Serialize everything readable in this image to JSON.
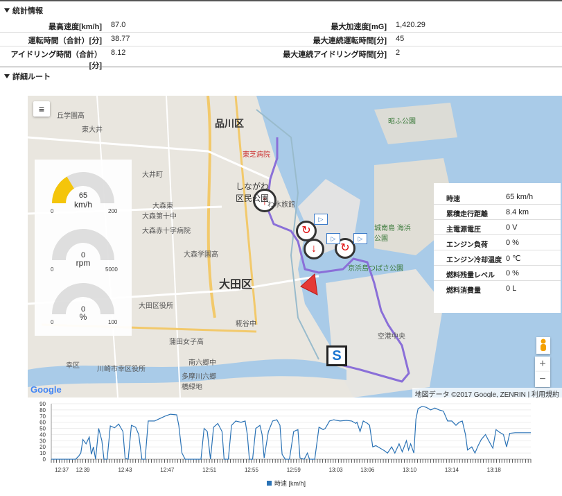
{
  "stats": {
    "title": "統計情報",
    "rows": [
      {
        "l1": "最高速度[km/h]",
        "v1": "87.0",
        "l2": "最大加速度[mG]",
        "v2": "1,420.29"
      },
      {
        "l1": "運転時間（合計）[分]",
        "v1": "38.77",
        "l2": "最大連続運転時間[分]",
        "v2": "45"
      },
      {
        "l1": "アイドリング時間（合計）[分]",
        "v1": "8.12",
        "l2": "最大連続アイドリング時間[分]",
        "v2": "2"
      }
    ]
  },
  "route": {
    "title": "詳細ルート",
    "menu_icon": "hamburger-icon",
    "gauges": [
      {
        "value": "65",
        "unit": "km/h",
        "min": "0",
        "max": "200",
        "fraction": 0.325,
        "color": "#f5c400"
      },
      {
        "value": "0",
        "unit": "rpm",
        "min": "0",
        "max": "5000",
        "fraction": 0,
        "color": "#f5c400"
      },
      {
        "value": "0",
        "unit": "%",
        "min": "0",
        "max": "100",
        "fraction": 0,
        "color": "#f5c400"
      }
    ],
    "info": [
      {
        "label": "時速",
        "value": "65 km/h"
      },
      {
        "label": "累積走行距離",
        "value": "8.4 km"
      },
      {
        "label": "主電源電圧",
        "value": "0 V"
      },
      {
        "label": "エンジン負荷",
        "value": "0 %"
      },
      {
        "label": "エンジン冷却温度",
        "value": "0 ℃"
      },
      {
        "label": "燃料残量レベル",
        "value": "0 %"
      },
      {
        "label": "燃料消費量",
        "value": "0 L"
      }
    ],
    "map_labels": [
      "品川区",
      "大田区",
      "しながわ 区民公園",
      "わ水族館",
      "城南島 海浜公園",
      "京浜島つばさ公園",
      "昭ふ公園",
      "大森学園高",
      "大森第十中",
      "大森赤十字病院",
      "東芝病院",
      "大田区役所",
      "糀谷中",
      "蒲田女子高",
      "南六郷中",
      "川崎市幸区役所",
      "多摩川六郷 橋緑地",
      "幸区",
      "丘学園高",
      "大井町",
      "東大井",
      "大森東",
      "空港中央"
    ],
    "google_logo": "Google",
    "attribution": "地図データ ©2017 Google, ZENRIN",
    "terms": "利用規約",
    "zoom_in": "+",
    "zoom_out": "−",
    "route_color": "#8a6fd8"
  },
  "chart_data": {
    "type": "line",
    "ylim": [
      0,
      90
    ],
    "yticks": [
      "0",
      "10",
      "20",
      "30",
      "40",
      "50",
      "60",
      "70",
      "80",
      "90"
    ],
    "xlim_minutes": [
      36.0,
      81.5
    ],
    "xticks": [
      "12:37",
      "12:39",
      "12:43",
      "12:47",
      "12:51",
      "12:55",
      "12:59",
      "13:03",
      "13:06",
      "13:10",
      "13:14",
      "13:18"
    ],
    "xtick_minutes": [
      37,
      39,
      43,
      47,
      51,
      55,
      59,
      63,
      66,
      70,
      74,
      78
    ],
    "series": [
      {
        "name": "時速 [km/h]",
        "color": "#2a72b5",
        "points": [
          [
            36.0,
            0
          ],
          [
            38.3,
            0
          ],
          [
            38.6,
            5
          ],
          [
            38.8,
            10
          ],
          [
            39.0,
            32
          ],
          [
            39.3,
            25
          ],
          [
            39.6,
            36
          ],
          [
            39.8,
            8
          ],
          [
            40.0,
            20
          ],
          [
            40.2,
            0
          ],
          [
            40.5,
            50
          ],
          [
            40.8,
            30
          ],
          [
            41.0,
            0
          ],
          [
            41.3,
            0
          ],
          [
            41.6,
            54
          ],
          [
            42.0,
            51
          ],
          [
            42.4,
            57
          ],
          [
            42.8,
            45
          ],
          [
            43.0,
            2
          ],
          [
            43.3,
            0
          ],
          [
            43.6,
            55
          ],
          [
            44.0,
            52
          ],
          [
            44.3,
            40
          ],
          [
            44.6,
            0
          ],
          [
            44.9,
            0
          ],
          [
            45.2,
            62
          ],
          [
            45.8,
            62
          ],
          [
            46.3,
            66
          ],
          [
            46.8,
            70
          ],
          [
            47.3,
            73
          ],
          [
            47.9,
            72
          ],
          [
            48.1,
            55
          ],
          [
            48.4,
            10
          ],
          [
            48.7,
            0
          ],
          [
            49.3,
            0
          ],
          [
            49.8,
            0
          ],
          [
            50.2,
            0
          ],
          [
            50.5,
            50
          ],
          [
            50.8,
            45
          ],
          [
            51.1,
            0
          ],
          [
            51.4,
            52
          ],
          [
            51.8,
            58
          ],
          [
            52.2,
            45
          ],
          [
            52.4,
            0
          ],
          [
            52.8,
            0
          ],
          [
            53.1,
            55
          ],
          [
            53.5,
            62
          ],
          [
            54.0,
            60
          ],
          [
            54.4,
            62
          ],
          [
            54.6,
            40
          ],
          [
            54.8,
            0
          ],
          [
            55.1,
            0
          ],
          [
            55.4,
            50
          ],
          [
            55.8,
            55
          ],
          [
            56.0,
            40
          ],
          [
            56.2,
            2
          ],
          [
            56.6,
            45
          ],
          [
            57.0,
            62
          ],
          [
            57.4,
            64
          ],
          [
            57.7,
            55
          ],
          [
            57.9,
            8
          ],
          [
            58.2,
            0
          ],
          [
            58.6,
            0
          ],
          [
            59.0,
            45
          ],
          [
            59.4,
            48
          ],
          [
            59.6,
            2
          ],
          [
            60.0,
            0
          ],
          [
            60.3,
            10
          ],
          [
            60.5,
            0
          ],
          [
            61.0,
            0
          ],
          [
            61.4,
            52
          ],
          [
            61.8,
            48
          ],
          [
            62.0,
            50
          ],
          [
            62.4,
            62
          ],
          [
            62.8,
            64
          ],
          [
            63.4,
            62
          ],
          [
            64.0,
            63
          ],
          [
            64.5,
            62
          ],
          [
            64.9,
            58
          ],
          [
            65.0,
            60
          ],
          [
            65.3,
            45
          ],
          [
            65.6,
            62
          ],
          [
            66.0,
            58
          ],
          [
            66.2,
            55
          ],
          [
            66.5,
            20
          ],
          [
            66.8,
            22
          ],
          [
            67.2,
            18
          ],
          [
            67.6,
            14
          ],
          [
            67.9,
            10
          ],
          [
            68.3,
            20
          ],
          [
            68.6,
            10
          ],
          [
            69.0,
            25
          ],
          [
            69.3,
            12
          ],
          [
            69.7,
            30
          ],
          [
            69.9,
            15
          ],
          [
            70.1,
            25
          ],
          [
            70.4,
            10
          ],
          [
            70.6,
            65
          ],
          [
            70.8,
            82
          ],
          [
            71.2,
            86
          ],
          [
            71.6,
            84
          ],
          [
            72.0,
            80
          ],
          [
            72.4,
            83
          ],
          [
            72.8,
            80
          ],
          [
            73.2,
            78
          ],
          [
            73.6,
            62
          ],
          [
            74.0,
            62
          ],
          [
            74.4,
            55
          ],
          [
            74.7,
            60
          ],
          [
            75.0,
            62
          ],
          [
            75.3,
            40
          ],
          [
            75.5,
            15
          ],
          [
            75.9,
            20
          ],
          [
            76.2,
            10
          ],
          [
            76.5,
            22
          ],
          [
            76.8,
            32
          ],
          [
            77.2,
            40
          ],
          [
            77.5,
            30
          ],
          [
            77.9,
            18
          ],
          [
            78.2,
            48
          ],
          [
            78.5,
            44
          ],
          [
            78.9,
            40
          ],
          [
            79.2,
            20
          ],
          [
            79.5,
            42
          ],
          [
            80.0,
            43
          ],
          [
            81.5,
            43
          ]
        ]
      }
    ],
    "legend": "時速 [km/h]"
  }
}
